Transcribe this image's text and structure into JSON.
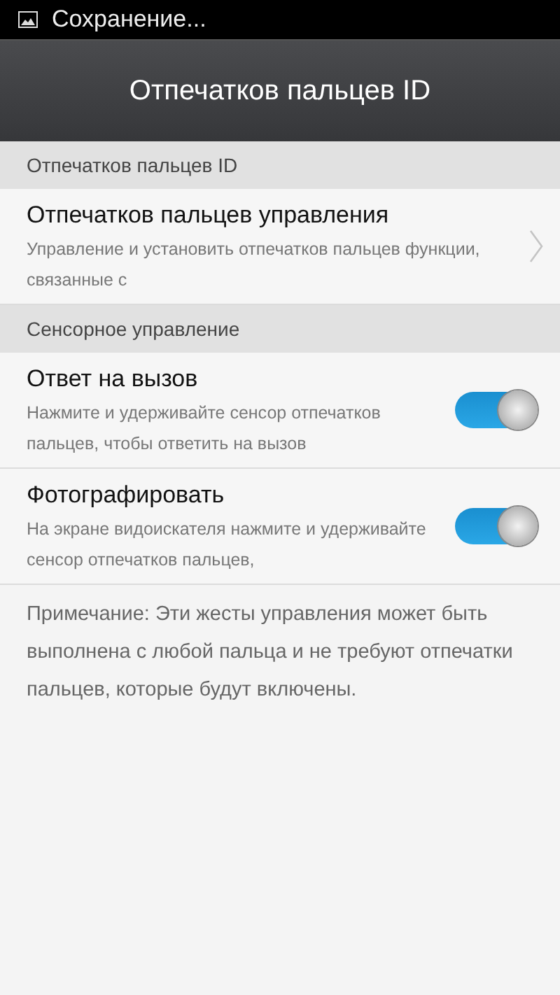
{
  "status_bar": {
    "notification": "Сохранение..."
  },
  "title_bar": {
    "title": "Отпечатков пальцев ID"
  },
  "sections": [
    {
      "header": "Отпечатков пальцев ID",
      "items": [
        {
          "kind": "link",
          "title": "Отпечатков пальцев управления",
          "description": "Управление и установить отпечатков пальцев функции, связанные с"
        }
      ]
    },
    {
      "header": "Сенсорное управление",
      "items": [
        {
          "kind": "toggle",
          "title": "Ответ на вызов",
          "description": "Нажмите и удерживайте сенсор отпечатков пальцев, чтобы ответить на вызов",
          "on": true
        },
        {
          "kind": "toggle",
          "title": "Фотографировать",
          "description": "На экране видоискателя нажмите и удерживайте сенсор отпечатков пальцев,",
          "on": true
        }
      ]
    }
  ],
  "note": "Примечание: Эти жесты управления может быть выполнена с любой пальца и не требуют отпечатки пальцев, которые будут включены."
}
